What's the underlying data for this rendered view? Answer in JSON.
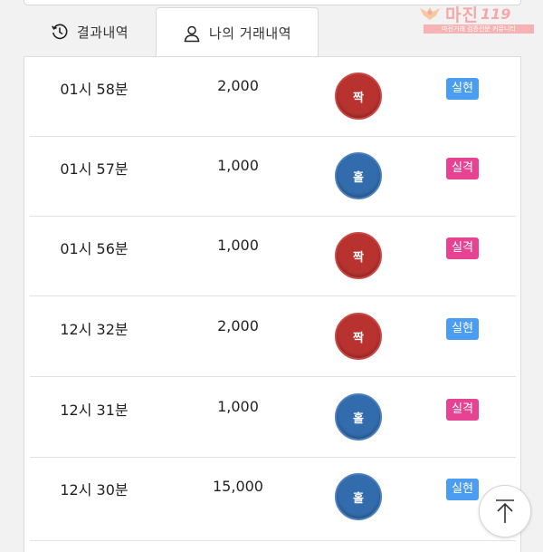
{
  "tabs": [
    {
      "label": "결과내역",
      "icon": "history-icon"
    },
    {
      "label": "나의 거래내역",
      "icon": "user-icon"
    }
  ],
  "logo": {
    "text": "마진",
    "num": "119",
    "sub": "마진거래 검증전문 커뮤니티"
  },
  "rows": [
    {
      "time": "01시 58분",
      "amount": "2,000",
      "pick": "짝",
      "pick_color": "red",
      "result": "실현",
      "result_type": "win"
    },
    {
      "time": "01시 57분",
      "amount": "1,000",
      "pick": "홀",
      "pick_color": "blue",
      "result": "실격",
      "result_type": "lose"
    },
    {
      "time": "01시 56분",
      "amount": "1,000",
      "pick": "짝",
      "pick_color": "red",
      "result": "실격",
      "result_type": "lose"
    },
    {
      "time": "12시 32분",
      "amount": "2,000",
      "pick": "짝",
      "pick_color": "red",
      "result": "실현",
      "result_type": "win"
    },
    {
      "time": "12시 31분",
      "amount": "1,000",
      "pick": "홀",
      "pick_color": "blue",
      "result": "실격",
      "result_type": "lose"
    },
    {
      "time": "12시 30분",
      "amount": "15,000",
      "pick": "홀",
      "pick_color": "blue",
      "result": "실현",
      "result_type": "win"
    }
  ],
  "colors": {
    "odd": "#336cad",
    "even": "#b83330",
    "win": "#4a9df0",
    "lose": "#e84393"
  },
  "scroll_top_icon": "arrow-up-to-top-icon"
}
